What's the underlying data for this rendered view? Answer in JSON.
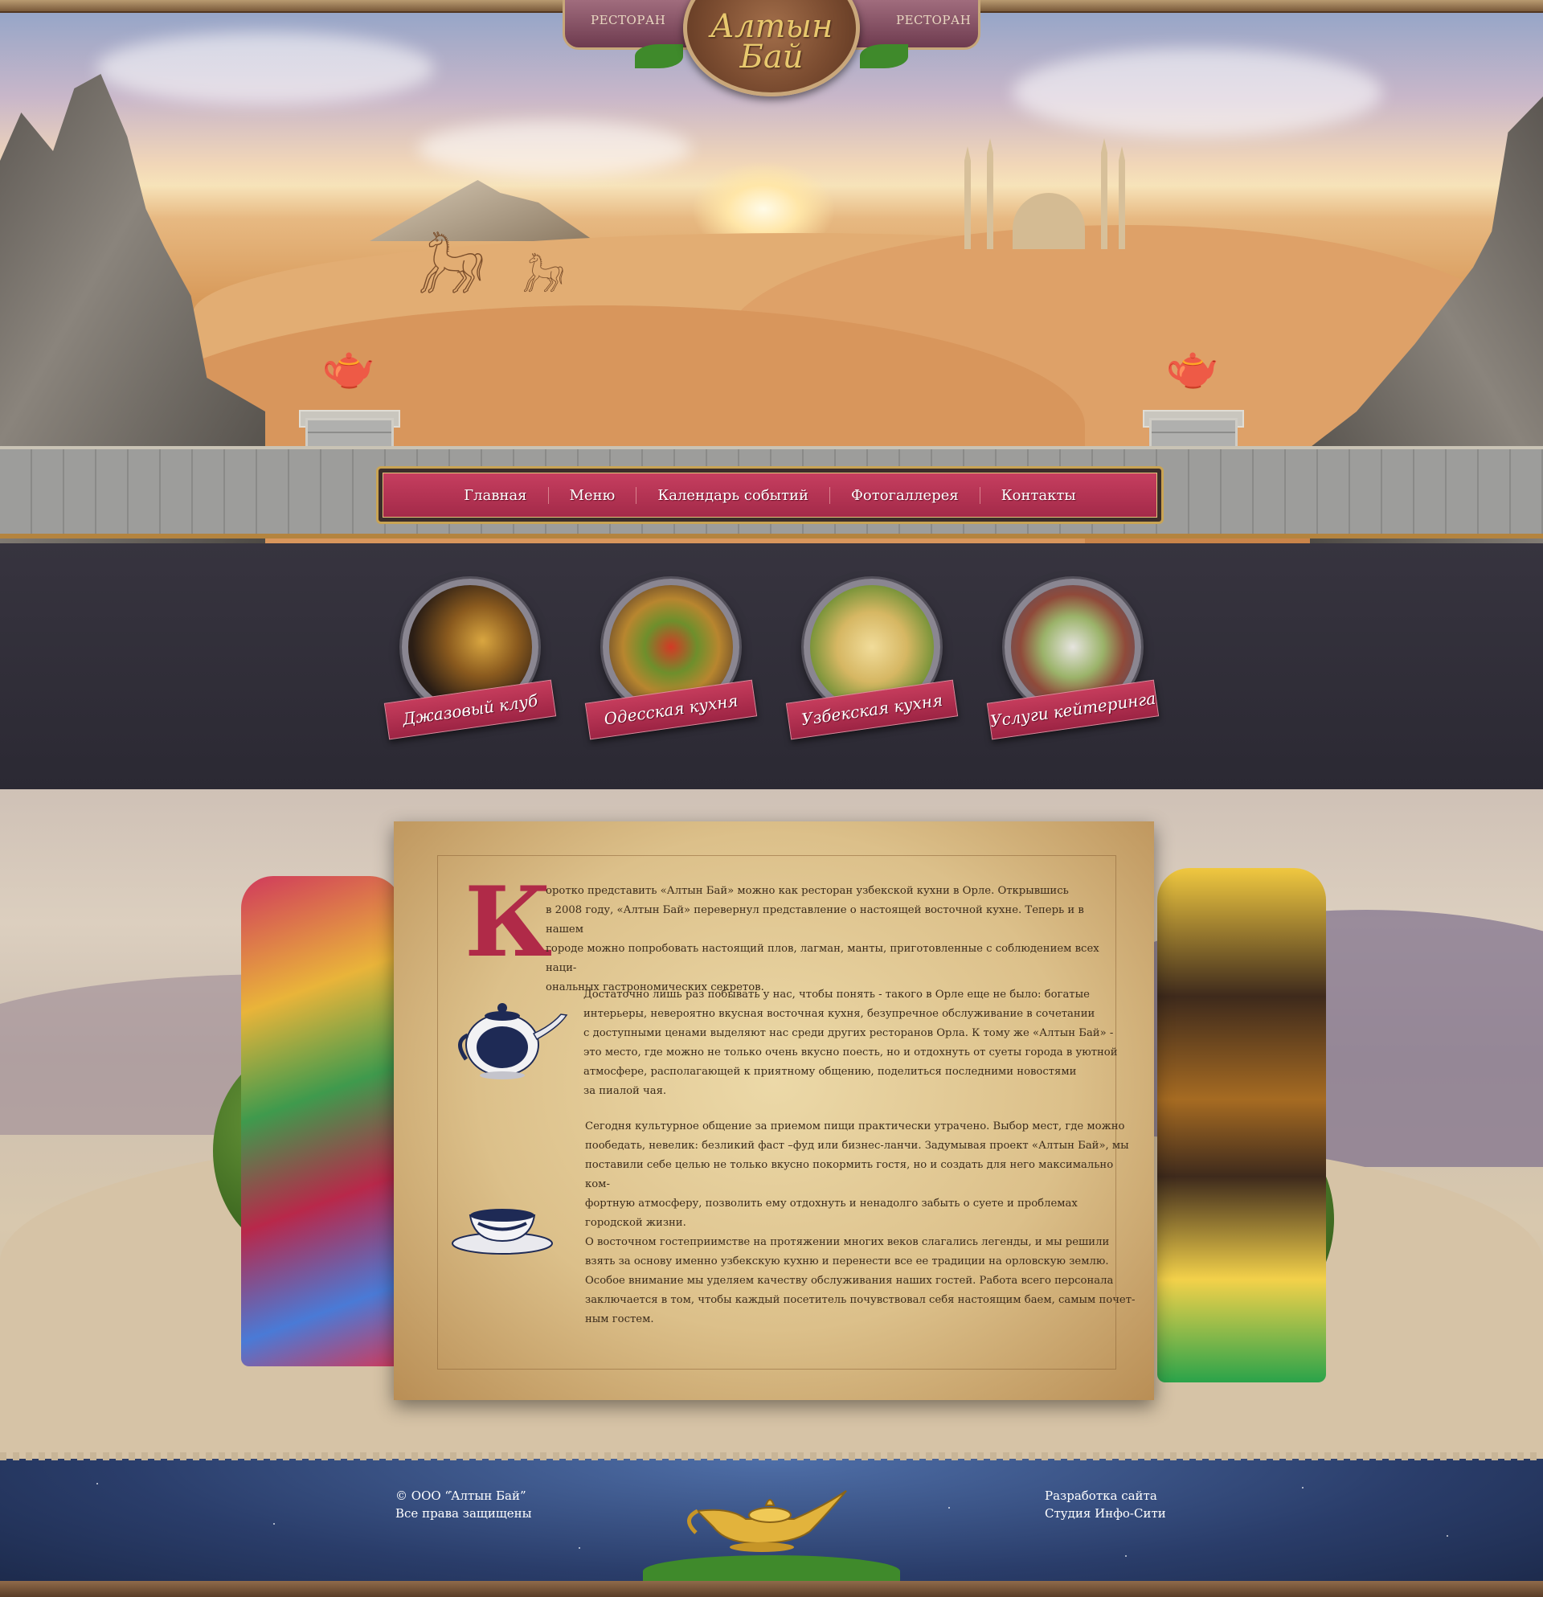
{
  "header": {
    "logo_text": "Алтын Бай",
    "logo_side_left": "РЕСТОРАН",
    "logo_side_right": "РЕСТОРАН"
  },
  "nav": {
    "items": [
      {
        "label": "Главная"
      },
      {
        "label": "Меню"
      },
      {
        "label": "Календарь событий"
      },
      {
        "label": "Фотогаллерея"
      },
      {
        "label": "Контакты"
      }
    ]
  },
  "services": [
    {
      "label": "Джазовый клуб",
      "icon": "saxophone-icon"
    },
    {
      "label": "Одесская кухня",
      "icon": "grilled-vegetables-icon"
    },
    {
      "label": "Узбекская кухня",
      "icon": "stuffed-cabbage-icon"
    },
    {
      "label": "Услуги кейтеринга",
      "icon": "catering-buffet-icon"
    }
  ],
  "about": {
    "drop_cap": "К",
    "p1": "оротко представить «Алтын Бай» можно как ресторан узбекской кухни в Орле. Открывшись\nв 2008 году, «Алтын Бай» перевернул представление о настоящей восточной кухне. Теперь и в нашем\nгороде можно попробовать настоящий плов, лагман, манты, приготовленные с соблюдением всех наци-\nональных гастрономических секретов.",
    "p2": "Достаточно лишь раз побывать у нас, чтобы понять - такого в Орле еще не было: богатые\nинтерьеры, невероятно вкусная восточная кухня, безупречное обслуживание в сочетании\nс доступными ценами выделяют нас среди других ресторанов Орла. К тому же «Алтын Бай» -\nэто место, где можно не только очень вкусно поесть, но и отдохнуть от суеты  города в уютной\nатмосфере, располагающей к приятному общению, поделиться последними новостями\nза пиалой чая.",
    "p3": "Сегодня культурное общение за приемом пищи практически утрачено.  Выбор мест, где можно\nпообедать, невелик: безликий фаст –фуд или бизнес-ланчи. Задумывая проект «Алтын Бай», мы\nпоставили себе целью не только вкусно покормить гостя, но и создать для него максимально ком-\nфортную атмосферу, позволить  ему отдохнуть и ненадолго забыть о суете и проблемах\nгородской жизни.",
    "p4": "О  восточном гостеприимстве на протяжении многих веков слагались легенды, и мы решили\nвзять за основу именно узбекскую кухню и перенести все ее традиции на орловскую землю.\nОсобое внимание мы уделяем качеству обслуживания наших гостей. Работа всего персонала\nзаключается в том, чтобы каждый посетитель почувствовал себя настоящим баем, самым почет-\nным гостем."
  },
  "footer": {
    "copyright": "© ООО “Алтын Бай”\nВсе права защищены",
    "developer": "Разработка сайта\nСтудия Инфо-Сити"
  },
  "colors": {
    "accent": "#b02a48",
    "nav_bg": "#c63e5f",
    "gold": "#c9a454",
    "services_bg": "#2b2933",
    "footer_bg": "#2a3d6a"
  }
}
